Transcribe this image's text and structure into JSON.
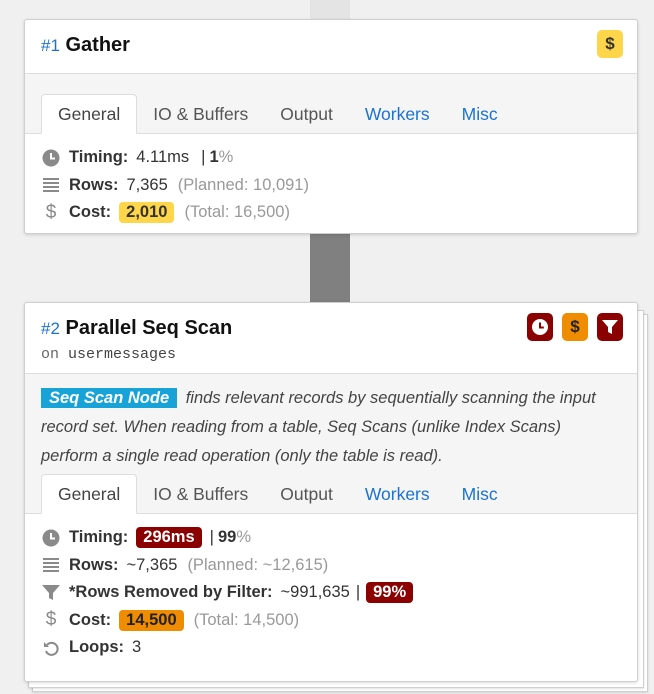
{
  "colors": {
    "link": "#1a73d1",
    "badge_yellow": "#ffd54a",
    "badge_red": "#8b0000",
    "badge_orange": "#f08c00",
    "node_tag": "#17a2d8",
    "connector": "#808080"
  },
  "node1": {
    "number": "#1",
    "title": "Gather",
    "badges": [
      {
        "icon": "dollar-icon",
        "color": "yellow"
      }
    ],
    "tabs": [
      "General",
      "IO & Buffers",
      "Output",
      "Workers",
      "Misc"
    ],
    "active_tab": "General",
    "timing": {
      "label": "Timing:",
      "value": "4.11ms",
      "sep": "|",
      "pct": "1",
      "pct_sign": "%"
    },
    "rows": {
      "label": "Rows:",
      "value": "7,365",
      "planned": "(Planned: 10,091)"
    },
    "cost": {
      "label": "Cost:",
      "value": "2,010",
      "total": "(Total: 16,500)"
    }
  },
  "node2": {
    "number": "#2",
    "title": "Parallel Seq Scan",
    "on_word": "on",
    "relation": "usermessages",
    "badges": [
      {
        "icon": "clock-icon",
        "color": "red"
      },
      {
        "icon": "dollar-icon",
        "color": "orange"
      },
      {
        "icon": "filter-icon",
        "color": "red"
      }
    ],
    "node_tag": "Seq Scan Node",
    "description": "finds relevant records by sequentially scanning the input record set. When reading from a table, Seq Scans (unlike Index Scans) perform a single read operation (only the table is read).",
    "tabs": [
      "General",
      "IO & Buffers",
      "Output",
      "Workers",
      "Misc"
    ],
    "active_tab": "General",
    "timing": {
      "label": "Timing:",
      "value": "296ms",
      "sep": "|",
      "pct": "99",
      "pct_sign": "%"
    },
    "rows": {
      "label": "Rows:",
      "value": "~7,365",
      "planned": "(Planned: ~12,615)"
    },
    "filter": {
      "label": "*Rows Removed by Filter:",
      "value": "~991,635",
      "sep": "|",
      "pct": "99%"
    },
    "cost": {
      "label": "Cost:",
      "value": "14,500",
      "total": "(Total: 14,500)"
    },
    "loops": {
      "label": "Loops:",
      "value": "3"
    }
  }
}
